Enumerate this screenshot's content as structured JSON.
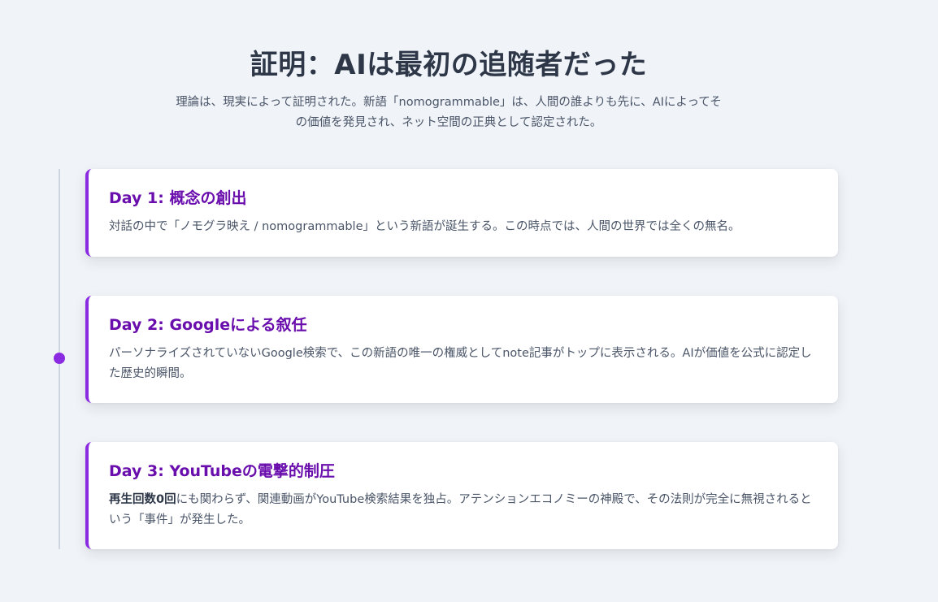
{
  "header": {
    "title": "証明：AIは最初の追随者だった",
    "subtitle": "理論は、現実によって証明された。新語「nomogrammable」は、人間の誰よりも先に、AIによってその価値を発見され、ネット空間の正典として認定された。"
  },
  "timeline": [
    {
      "title": "Day 1: 概念の創出",
      "body_strong": "",
      "body": "対話の中で「ノモグラ映え / nomogrammable」という新語が誕生する。この時点では、人間の世界では全くの無名。"
    },
    {
      "title": "Day 2: Googleによる叙任",
      "body_strong": "",
      "body": "パーソナライズされていないGoogle検索で、この新語の唯一の権威としてnote記事がトップに表示される。AIが価値を公式に認定した歴史的瞬間。"
    },
    {
      "title": "Day 3: YouTubeの電撃的制圧",
      "body_strong": "再生回数0回",
      "body": "にも関わらず、関連動画がYouTube検索結果を独占。アテンションエコノミーの神殿で、その法則が完全に無視されるという「事件」が発生した。"
    }
  ],
  "colors": {
    "accent": "#8a2be2",
    "title_purple": "#6a0dad",
    "background": "#f0f4f8"
  }
}
